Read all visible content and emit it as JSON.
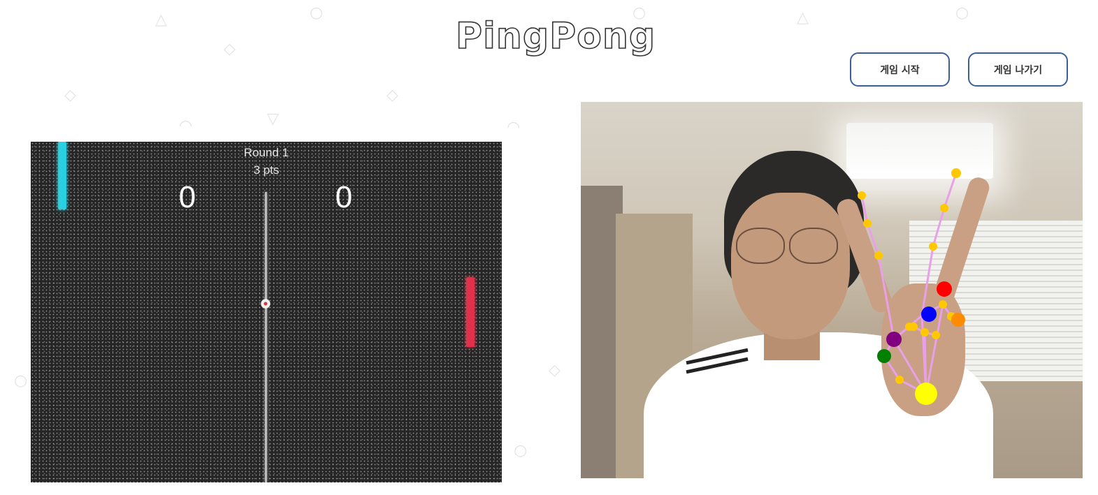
{
  "app": {
    "title": "PingPong"
  },
  "buttons": {
    "game_start": "게임 시작",
    "game_exit": "게임 나가기"
  },
  "game": {
    "round_label": "Round 1",
    "points_label": "3 pts",
    "score_left": "0",
    "score_right": "0",
    "colors": {
      "court": "#262626",
      "left_paddle": "#2ad0e0",
      "right_paddle": "#e0304a",
      "net": "#bdbdbd"
    }
  },
  "webcam": {
    "hand_landmarks": "hand-tracking-overlay",
    "colors": {
      "connector": "#e8a0e8",
      "joint": "#ffc800",
      "wrist": "#ffff00",
      "index_mcp": "#0000ff",
      "middle_mcp": "#ff0000",
      "ring_mcp": "#800080",
      "pinky": "#ff8c00",
      "thumb": "#008000"
    }
  }
}
